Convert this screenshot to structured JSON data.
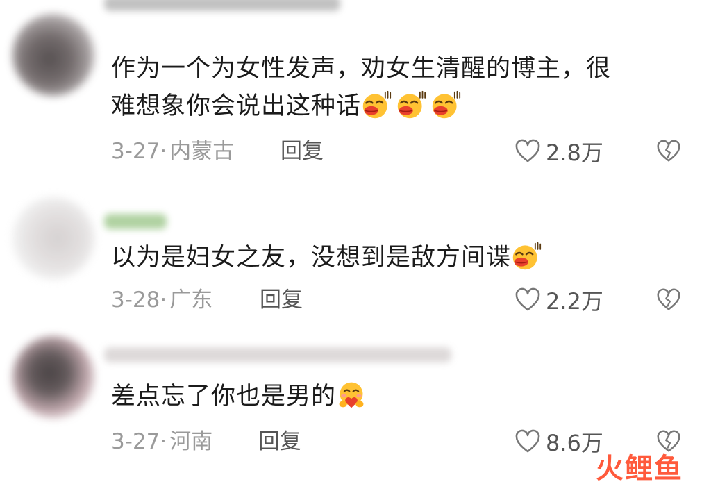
{
  "comments": [
    {
      "text_line1": "作为一个为女性发声，劝女生清醒的博主，很",
      "text_line2": "难想象你会说出这种话",
      "emojis": [
        "blowing-kiss-emoji",
        "blowing-kiss-emoji",
        "blowing-kiss-emoji"
      ],
      "date": "3-27·",
      "region": "内蒙古",
      "reply_label": "回复",
      "likes": "2.8万"
    },
    {
      "text_line1": "以为是妇女之友，没想到是敌方间谍",
      "emojis": [
        "blowing-kiss-emoji"
      ],
      "date": "3-28·",
      "region": "广东",
      "reply_label": "回复",
      "likes": "2.2万"
    },
    {
      "text_line1": "差点忘了你也是男的",
      "emojis": [
        "heart-hug-emoji"
      ],
      "date": "3-27·",
      "region": "河南",
      "reply_label": "回复",
      "likes": "8.6万"
    }
  ],
  "watermark": {
    "text": "火鲤鱼"
  },
  "colors": {
    "watermark": "#ff5a3c",
    "meta": "#9a9a9a",
    "emoji_face": "#ffc233",
    "emoji_lips": "#e8402c"
  }
}
